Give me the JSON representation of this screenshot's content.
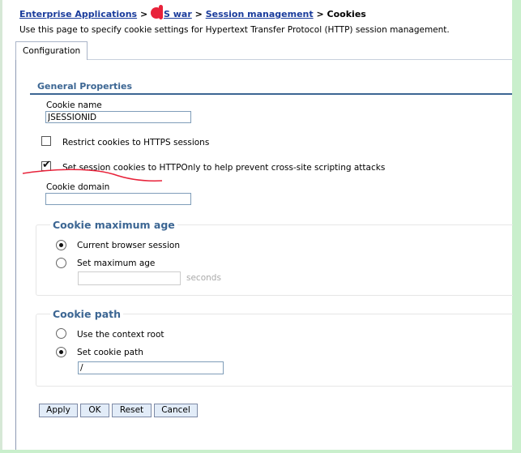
{
  "breadcrumb": {
    "items": [
      "Enterprise Applications",
      "S war",
      "Session management"
    ],
    "current": "Cookies",
    "separator": ">"
  },
  "description": "Use this page to specify cookie settings for Hypertext Transfer Protocol (HTTP) session management.",
  "tabs": [
    {
      "label": "Configuration",
      "active": true
    }
  ],
  "general_properties": {
    "heading": "General Properties",
    "cookie_name": {
      "label": "Cookie name",
      "value": "JSESSIONID"
    },
    "restrict_https": {
      "label": "Restrict cookies to HTTPS sessions",
      "checked": false
    },
    "http_only": {
      "label": "Set session cookies to HTTPOnly to help prevent cross-site scripting attacks",
      "checked": true
    },
    "cookie_domain": {
      "label": "Cookie domain",
      "value": ""
    }
  },
  "max_age": {
    "legend": "Cookie maximum age",
    "options": [
      {
        "label": "Current browser session",
        "selected": true
      },
      {
        "label": "Set maximum age",
        "selected": false
      }
    ],
    "value": "",
    "unit": "seconds"
  },
  "cookie_path": {
    "legend": "Cookie path",
    "options": [
      {
        "label": "Use the context root",
        "selected": false
      },
      {
        "label": "Set cookie path",
        "selected": true
      }
    ],
    "value": "/"
  },
  "buttons": {
    "apply": "Apply",
    "ok": "OK",
    "reset": "Reset",
    "cancel": "Cancel"
  },
  "colors": {
    "link": "#1a3c9c",
    "heading": "#3c6693",
    "annotation": "#e8223a",
    "frame": "#c9efcc"
  }
}
